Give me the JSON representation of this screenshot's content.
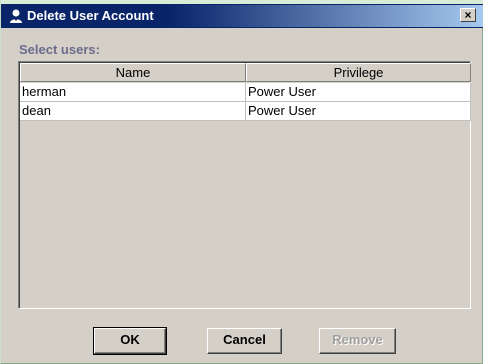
{
  "window": {
    "title": "Delete User Account",
    "close_label": "×",
    "icon": "user-icon"
  },
  "content": {
    "select_label": "Select users:"
  },
  "table": {
    "columns": [
      "Name",
      "Privilege"
    ],
    "rows": [
      {
        "name": "herman",
        "privilege": "Power User"
      },
      {
        "name": "dean",
        "privilege": "Power User"
      }
    ]
  },
  "buttons": {
    "ok": "OK",
    "cancel": "Cancel",
    "remove": "Remove"
  },
  "colors": {
    "title_bar": "#0a246a",
    "dialog_bg": "#d4d0c8",
    "label_color": "#6b6b8c"
  }
}
